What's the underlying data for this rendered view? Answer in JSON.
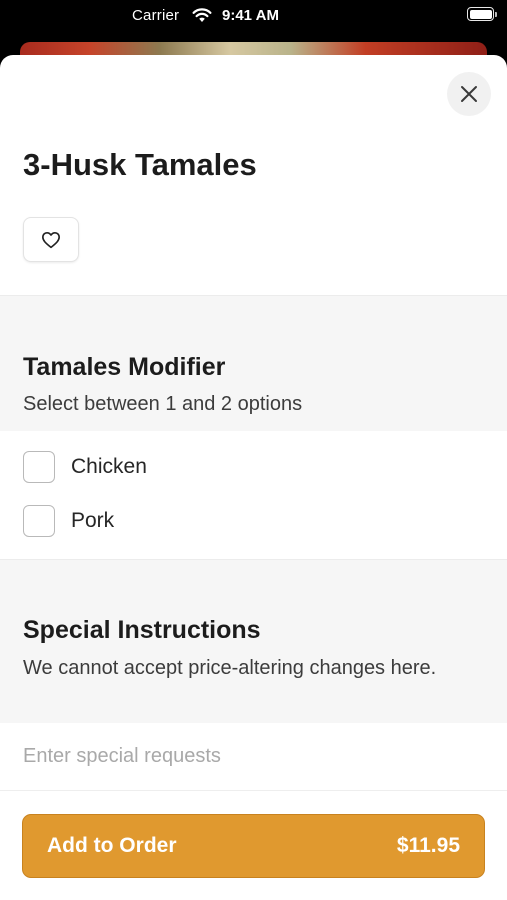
{
  "status_bar": {
    "carrier": "Carrier",
    "time": "9:41 AM"
  },
  "item": {
    "title": "3-Husk Tamales"
  },
  "modifier": {
    "title": "Tamales Modifier",
    "subtitle": "Select between 1 and 2 options",
    "options": [
      {
        "label": "Chicken",
        "checked": false
      },
      {
        "label": "Pork",
        "checked": false
      }
    ]
  },
  "instructions": {
    "title": "Special Instructions",
    "subtitle": "We cannot accept price-altering changes here.",
    "placeholder": "Enter special requests",
    "value": ""
  },
  "order_button": {
    "label": "Add to Order",
    "price": "$11.95"
  },
  "colors": {
    "accent": "#e0992f",
    "section_bg": "#f6f6f6"
  },
  "icons": {
    "close": "close-icon",
    "favorite": "heart-icon",
    "wifi": "wifi-icon",
    "battery": "battery-icon"
  }
}
